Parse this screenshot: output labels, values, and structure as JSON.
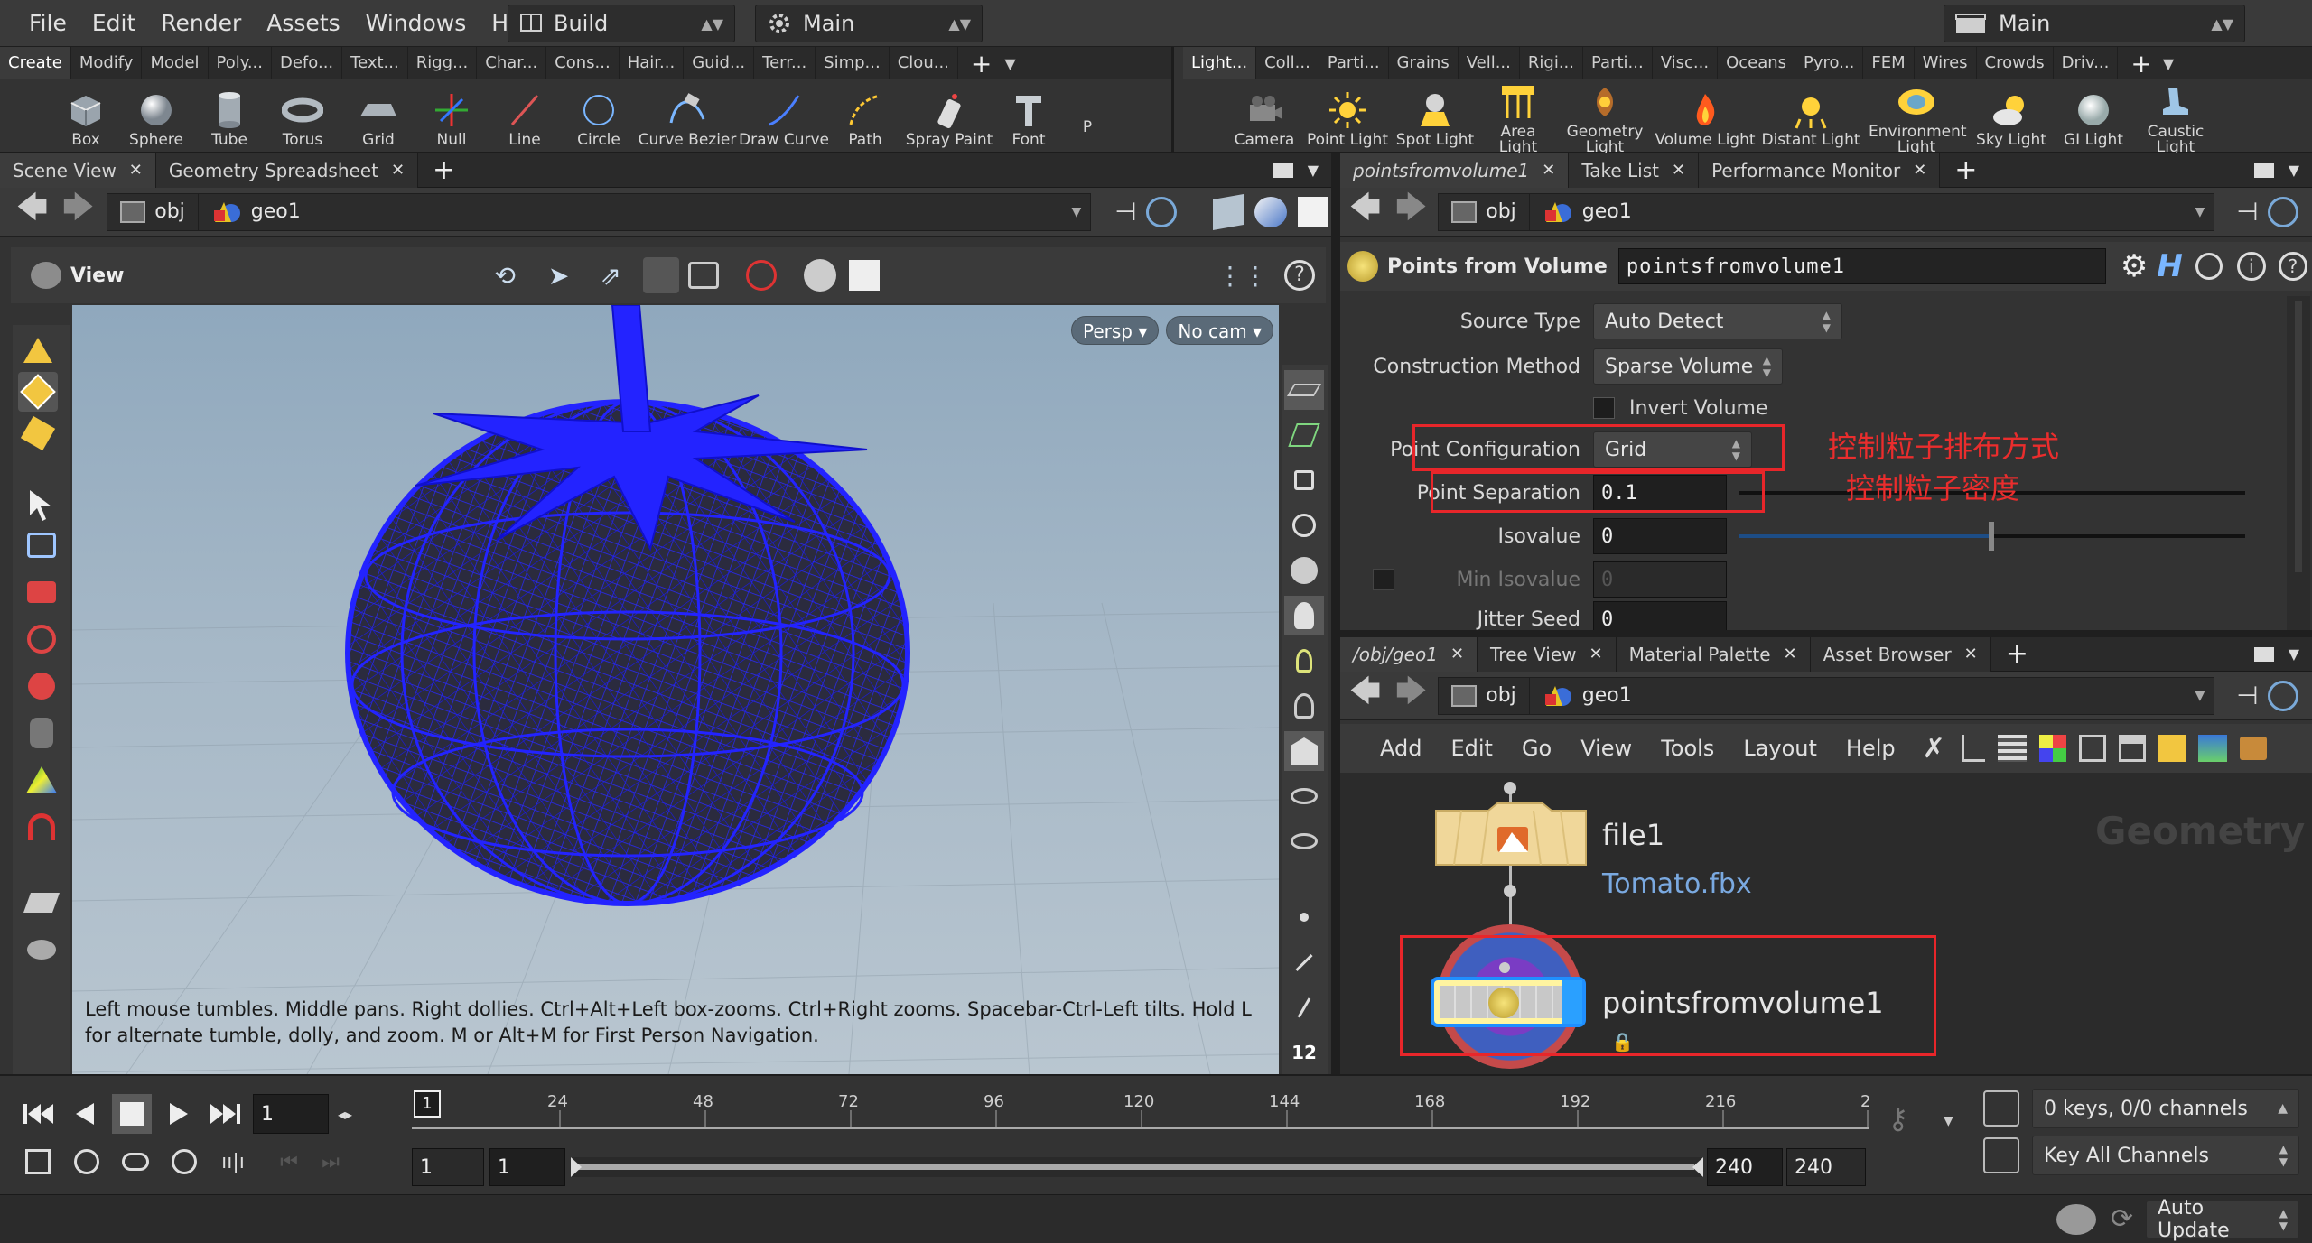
{
  "menubar": {
    "items": [
      "File",
      "Edit",
      "Render",
      "Assets",
      "Windows",
      "Help"
    ],
    "desktop": "Build",
    "context": "Main",
    "right_context": "Main"
  },
  "shelf": {
    "left_tabs": [
      "Create",
      "Modify",
      "Model",
      "Poly...",
      "Defo...",
      "Text...",
      "Rigg...",
      "Char...",
      "Cons...",
      "Hair...",
      "Guid...",
      "Terr...",
      "Simp...",
      "Clou..."
    ],
    "right_tabs": [
      "Light...",
      "Coll...",
      "Parti...",
      "Grains",
      "Vell...",
      "Rigi...",
      "Parti...",
      "Visc...",
      "Oceans",
      "Pyro...",
      "FEM",
      "Wires",
      "Crowds",
      "Driv..."
    ],
    "left_tools": [
      "Box",
      "Sphere",
      "Tube",
      "Torus",
      "Grid",
      "Null",
      "Line",
      "Circle",
      "Curve Bezier",
      "Draw Curve",
      "Path",
      "Spray Paint",
      "Font"
    ],
    "right_tools": [
      "Camera",
      "Point Light",
      "Spot Light",
      "Area Light",
      "Geometry Light",
      "Volume Light",
      "Distant Light",
      "Environment Light",
      "Sky Light",
      "GI Light",
      "Caustic Light"
    ],
    "more_label": "P"
  },
  "left_pane": {
    "tabs": [
      "Scene View",
      "Geometry Spreadsheet"
    ],
    "path": {
      "obj": "obj",
      "geo": "geo1"
    },
    "view_label": "View",
    "hud": {
      "persp": "Persp",
      "cam": "No cam"
    },
    "hint": "Left mouse tumbles. Middle pans. Right dollies. Ctrl+Alt+Left box-zooms. Ctrl+Right zooms. Spacebar-Ctrl-Left tilts. Hold L for alternate tumble, dolly, and zoom.    M or Alt+M for First Person Navigation.",
    "side_number": "12"
  },
  "params_pane": {
    "tabs": [
      "pointsfromvolume1",
      "Take List",
      "Performance Monitor"
    ],
    "path": {
      "obj": "obj",
      "geo": "geo1"
    },
    "node_type": "Points from Volume",
    "node_name": "pointsfromvolume1",
    "rows": {
      "source_type": {
        "label": "Source Type",
        "value": "Auto Detect"
      },
      "construction": {
        "label": "Construction Method",
        "value": "Sparse Volume"
      },
      "invert": {
        "label": "Invert Volume"
      },
      "point_config": {
        "label": "Point Configuration",
        "value": "Grid"
      },
      "point_sep": {
        "label": "Point Separation",
        "value": "0.1"
      },
      "isovalue": {
        "label": "Isovalue",
        "value": "0"
      },
      "min_isovalue": {
        "label": "Min Isovalue",
        "value": "0"
      },
      "jitter": {
        "label": "Jitter Seed",
        "value": "0"
      }
    },
    "annotations": {
      "config_note": "控制粒子排布方式",
      "sep_note": "控制粒子密度"
    },
    "accent_red": "#e8262a"
  },
  "network_pane": {
    "tabs": [
      "/obj/geo1",
      "Tree View",
      "Material Palette",
      "Asset Browser"
    ],
    "path": {
      "obj": "obj",
      "geo": "geo1"
    },
    "menu": [
      "Add",
      "Edit",
      "Go",
      "View",
      "Tools",
      "Layout",
      "Help"
    ],
    "watermark": "Geometry",
    "nodes": [
      {
        "name": "file1",
        "sub": "Tomato.fbx"
      },
      {
        "name": "pointsfromvolume1"
      }
    ]
  },
  "timeline": {
    "current_frame": "1",
    "marker": "1",
    "ticks": [
      "24",
      "48",
      "72",
      "96",
      "120",
      "144",
      "168",
      "192",
      "216",
      "2"
    ],
    "start": "1",
    "start2": "1",
    "end": "240",
    "end2": "240",
    "keys_status": "0 keys, 0/0 channels",
    "key_all": "Key All Channels",
    "auto_update": "Auto Update"
  }
}
